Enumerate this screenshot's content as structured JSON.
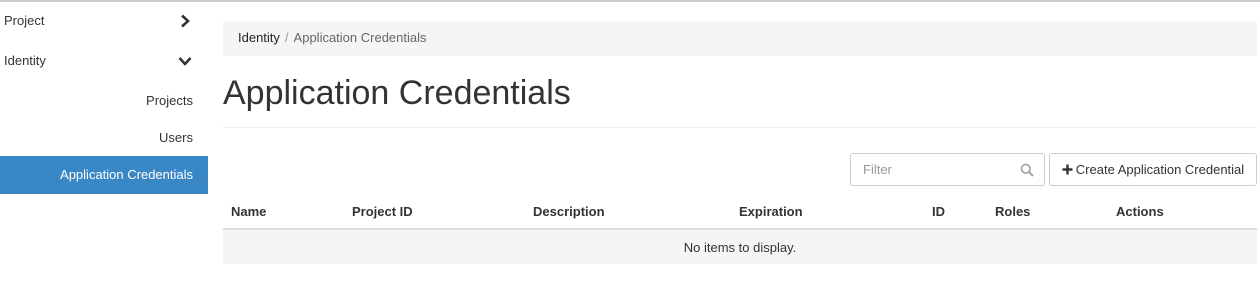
{
  "sidebar": {
    "project": {
      "label": "Project"
    },
    "identity": {
      "label": "Identity"
    },
    "items": [
      {
        "label": "Projects"
      },
      {
        "label": "Users"
      },
      {
        "label": "Application Credentials"
      }
    ]
  },
  "breadcrumb": {
    "parent": "Identity",
    "separator": "/",
    "current": "Application Credentials"
  },
  "page": {
    "title": "Application Credentials"
  },
  "toolbar": {
    "filter_placeholder": "Filter",
    "filter_value": "",
    "create_label": "Create Application Credential"
  },
  "table": {
    "columns": [
      "Name",
      "Project ID",
      "Description",
      "Expiration",
      "ID",
      "Roles",
      "Actions"
    ],
    "empty_message": "No items to display."
  },
  "icons": {
    "project_chevron": "chevron-right-icon",
    "identity_chevron": "chevron-down-icon",
    "filter": "search-icon",
    "create": "plus-icon"
  },
  "colors": {
    "active_nav": "#3a87c6",
    "breadcrumb_bg": "#f5f5f5"
  }
}
